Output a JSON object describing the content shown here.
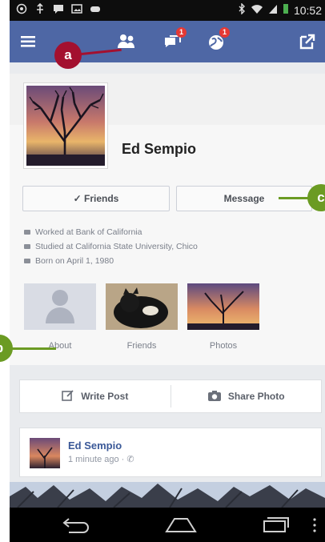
{
  "status_bar": {
    "time": "10:52"
  },
  "app_bar": {
    "messages_badge": "1",
    "notifications_badge": "1"
  },
  "callouts": {
    "a": "a",
    "b": "b",
    "c": "c"
  },
  "profile": {
    "name": "Ed Sempio",
    "friends_button": "✓ Friends",
    "message_button": "Message",
    "info": [
      "Worked at Bank of California",
      "Studied at California State University, Chico",
      "Born on April 1, 1980"
    ],
    "tiles": [
      "About",
      "Friends",
      "Photos"
    ]
  },
  "composer": {
    "write_post": "Write Post",
    "share_photo": "Share Photo"
  },
  "post": {
    "author": "Ed Sempio",
    "meta": "1 minute ago · ✆"
  },
  "colors": {
    "facebook_blue": "#4e67a5",
    "callout_red": "#a3102f",
    "callout_green": "#6b9b23"
  }
}
